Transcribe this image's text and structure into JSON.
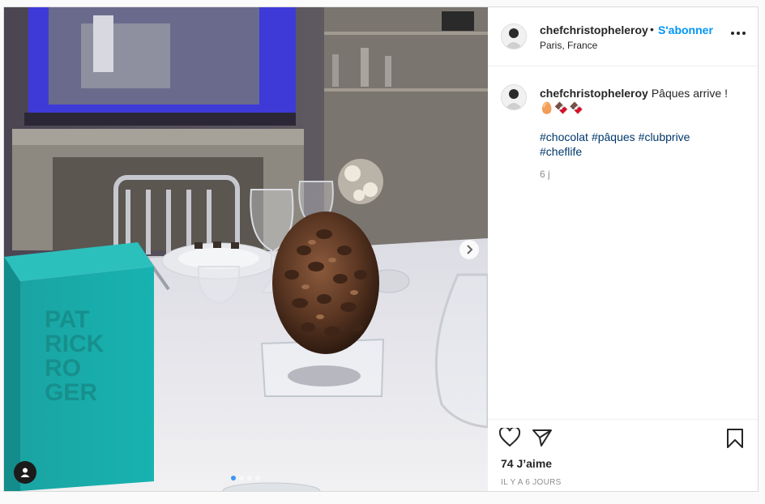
{
  "post": {
    "username": "chefchristopheleroy",
    "separator": "•",
    "follow_label": "S'abonner",
    "location": "Paris, France",
    "more_icon": "more-options-icon",
    "caption_text": "Pâques arrive !",
    "caption_emojis": "🥚🍫🍫",
    "hashtags": [
      "#chocolat",
      "#pâques",
      "#clubprive",
      "#cheflife"
    ],
    "time_short": "6 j",
    "likes": "74 J’aime",
    "timestamp": "IL Y A 6 JOURS",
    "box_brand_text": [
      "PAT",
      "RICK",
      "RO",
      "GER"
    ],
    "carousel": {
      "count": 4,
      "active": 0
    },
    "icons": {
      "like": "heart-icon",
      "share": "share-icon",
      "save": "bookmark-icon",
      "next": "chevron-right-icon",
      "tag": "user-tag-icon"
    },
    "colors": {
      "follow_blue": "#0095f6",
      "hashtag_blue": "#00376b",
      "muted_grey": "#8e8e8e",
      "box_teal": "#1fa7a5"
    }
  }
}
